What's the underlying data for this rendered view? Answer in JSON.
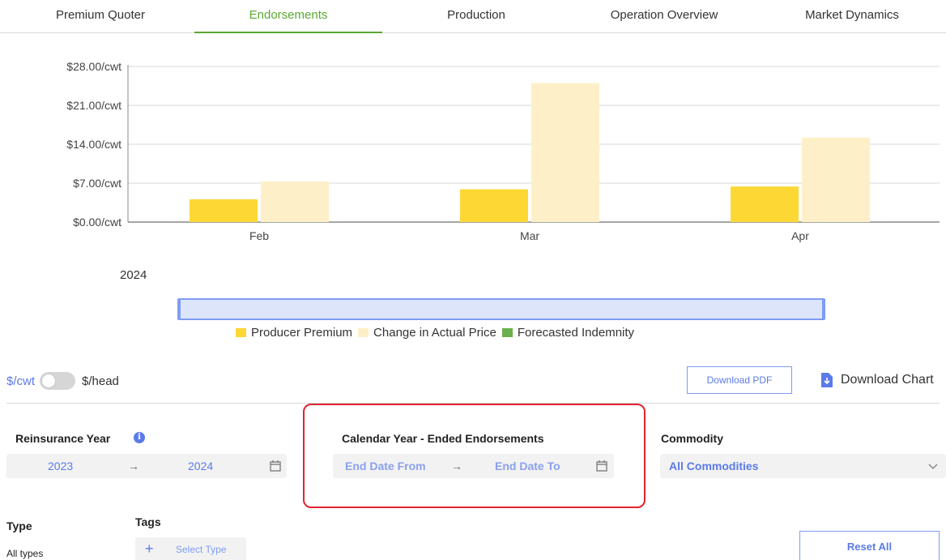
{
  "tabs": [
    {
      "label": "Premium Quoter",
      "active": false
    },
    {
      "label": "Endorsements",
      "active": true
    },
    {
      "label": "Production",
      "active": false
    },
    {
      "label": "Operation Overview",
      "active": false
    },
    {
      "label": "Market Dynamics",
      "active": false
    }
  ],
  "chart_data": {
    "type": "bar",
    "categories": [
      "Feb",
      "Mar",
      "Apr"
    ],
    "series": [
      {
        "name": "Producer Premium",
        "values": [
          4.1,
          5.9,
          6.4
        ],
        "color": "#fdd835"
      },
      {
        "name": "Change in Actual Price",
        "values": [
          7.3,
          25.0,
          15.2
        ],
        "color": "#fdf0c8"
      },
      {
        "name": "Forecasted Indemnity",
        "values": [
          0,
          0,
          0
        ],
        "color": "#6ab04c"
      }
    ],
    "y_ticks": [
      "$0.00/cwt",
      "$7.00/cwt",
      "$14.00/cwt",
      "$21.00/cwt",
      "$28.00/cwt"
    ],
    "ylim": [
      0,
      28
    ],
    "grid": true,
    "legend_position": "bottom"
  },
  "chart_meta": {
    "year_label": "2024"
  },
  "units": {
    "left": "$/cwt",
    "right": "$/head"
  },
  "actions": {
    "download_pdf": "Download PDF",
    "download_chart": "Download Chart",
    "reset_all": "Reset All"
  },
  "filters": {
    "reinsurance_year": {
      "label": "Reinsurance Year",
      "from": "2023",
      "to": "2024"
    },
    "calendar_year": {
      "label": "Calendar Year - Ended Endorsements",
      "from_placeholder": "End Date From",
      "to_placeholder": "End Date To"
    },
    "commodity": {
      "label": "Commodity",
      "value": "All Commodities"
    },
    "type": {
      "label": "Type",
      "value": "All types"
    },
    "tags": {
      "label": "Tags",
      "placeholder": "Select Type"
    }
  },
  "icons": {
    "info": "i",
    "arrow": "→",
    "plus": "+"
  }
}
